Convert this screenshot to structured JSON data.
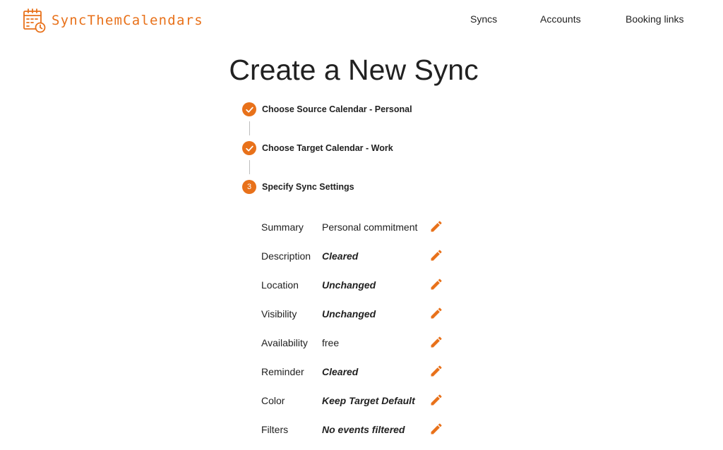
{
  "brand": {
    "name": "SyncThemCalendars",
    "accent_color": "#E8711A",
    "logo_icon": "calendar-sync-icon"
  },
  "nav": {
    "syncs": "Syncs",
    "accounts": "Accounts",
    "booking_links": "Booking links"
  },
  "page": {
    "title": "Create a New Sync"
  },
  "stepper": {
    "steps": [
      {
        "status": "completed",
        "icon": "check-icon",
        "label": "Choose Source Calendar - Personal"
      },
      {
        "status": "completed",
        "icon": "check-icon",
        "label": "Choose Target Calendar - Work"
      },
      {
        "status": "active",
        "number": "3",
        "label": "Specify Sync Settings"
      }
    ]
  },
  "settings": {
    "edit_icon": "pencil-icon",
    "rows": [
      {
        "key": "Summary",
        "value": "Personal commitment",
        "emphasized": false
      },
      {
        "key": "Description",
        "value": "Cleared",
        "emphasized": true
      },
      {
        "key": "Location",
        "value": "Unchanged",
        "emphasized": true
      },
      {
        "key": "Visibility",
        "value": "Unchanged",
        "emphasized": true
      },
      {
        "key": "Availability",
        "value": "free",
        "emphasized": false
      },
      {
        "key": "Reminder",
        "value": "Cleared",
        "emphasized": true
      },
      {
        "key": "Color",
        "value": "Keep Target Default",
        "emphasized": true
      },
      {
        "key": "Filters",
        "value": "No events filtered",
        "emphasized": true
      }
    ]
  }
}
